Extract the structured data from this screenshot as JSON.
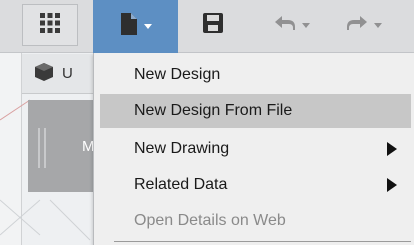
{
  "toolbar": {
    "apps_icon": "grid-icon",
    "file_icon": "file-icon",
    "save_icon": "save-icon",
    "undo_icon": "undo-icon",
    "redo_icon": "redo-icon",
    "accent": "#5d8fc3"
  },
  "browser": {
    "label": "U",
    "icon": "cube-icon"
  },
  "doc_tab": {
    "label": "M"
  },
  "file_menu": {
    "items": [
      {
        "label": "New Design"
      },
      {
        "label": "New Design From File",
        "hovered": true
      },
      {
        "label": "New Drawing",
        "submenu": true
      },
      {
        "label": "Related Data",
        "submenu": true
      },
      {
        "label": "Open Details on Web",
        "disabled": true
      }
    ]
  }
}
